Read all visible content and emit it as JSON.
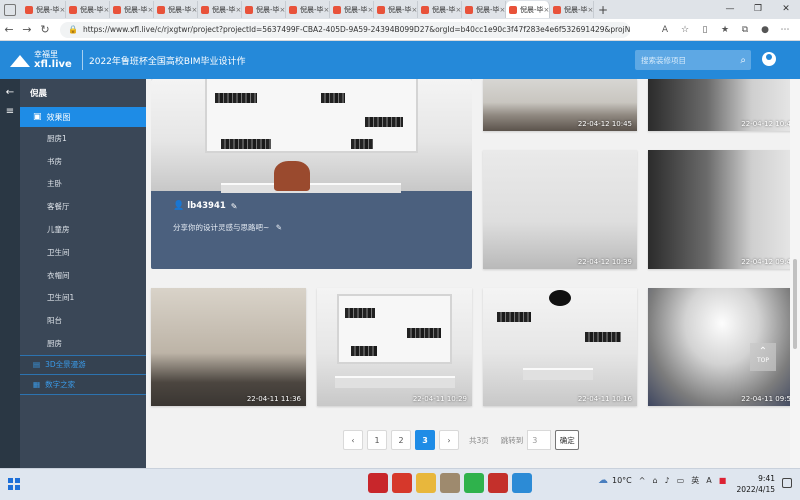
{
  "browser": {
    "tabs": [
      {
        "label": "倪晨-毕"
      },
      {
        "label": "倪晨-毕"
      },
      {
        "label": "倪晨-毕"
      },
      {
        "label": "倪晨-毕"
      },
      {
        "label": "倪晨-毕"
      },
      {
        "label": "倪晨-毕"
      },
      {
        "label": "倪晨-毕"
      },
      {
        "label": "倪晨-毕"
      },
      {
        "label": "倪晨-毕"
      },
      {
        "label": "倪晨-毕"
      },
      {
        "label": "倪晨-毕"
      },
      {
        "label": "倪晨-毕"
      },
      {
        "label": "倪晨-毕"
      }
    ],
    "new_tab_glyph": "+",
    "url": "https://www.xfl.live/c/rjxgtwr/project?projectId=5637499F-CBA2-405D-9A59-24394B099D27&orgId=b40cc1e90c3f47f283e4e6f532691429&projName=倪晨"
  },
  "header": {
    "logo_cn": "幸福里",
    "logo_en": "xfl.live",
    "title": "2022年鲁班杯全国高校BIM毕业设计作",
    "search_placeholder": "搜索装修项目"
  },
  "sidebar": {
    "project_name": "倪晨",
    "active_group": "效果图",
    "items": [
      {
        "label": "厨房1"
      },
      {
        "label": "书房"
      },
      {
        "label": "主卧"
      },
      {
        "label": "客餐厅"
      },
      {
        "label": "儿童房"
      },
      {
        "label": "卫生间"
      },
      {
        "label": "衣帽间"
      },
      {
        "label": "卫生间1"
      },
      {
        "label": "阳台"
      },
      {
        "label": "厨房"
      }
    ],
    "links": [
      {
        "label": "3D全景漫游"
      },
      {
        "label": "数字之家"
      }
    ]
  },
  "feature": {
    "owner": "lb43941",
    "description": "分享你的设计灵感与思路吧~"
  },
  "gallery": [
    {
      "date": "22-04-12 10:45"
    },
    {
      "date": "22-04-12 10:4"
    },
    {
      "date": "22-04-12 10:39"
    },
    {
      "date": "22-04-12 09:4"
    },
    {
      "date": "22-04-11 11:36"
    },
    {
      "date": "22-04-11 10:29"
    },
    {
      "date": "22-04-11 10:16"
    },
    {
      "date": "22-04-11 09:5"
    }
  ],
  "to_top_label": "TOP",
  "pagination": {
    "prev": "‹",
    "pages": [
      "1",
      "2",
      "3"
    ],
    "current": "3",
    "next": "›",
    "total": "共3页",
    "jump_label": "跳转到",
    "jump_value": "3",
    "confirm": "确定"
  },
  "taskbar": {
    "weather": "10°C",
    "lang": "英",
    "time": "9:41",
    "date": "2022/4/15"
  },
  "colors": {
    "brand_blue": "#2589d9",
    "sidebar_bg": "#3a4757",
    "active_item": "#1e8ce6",
    "feature_card": "#4b607e"
  }
}
